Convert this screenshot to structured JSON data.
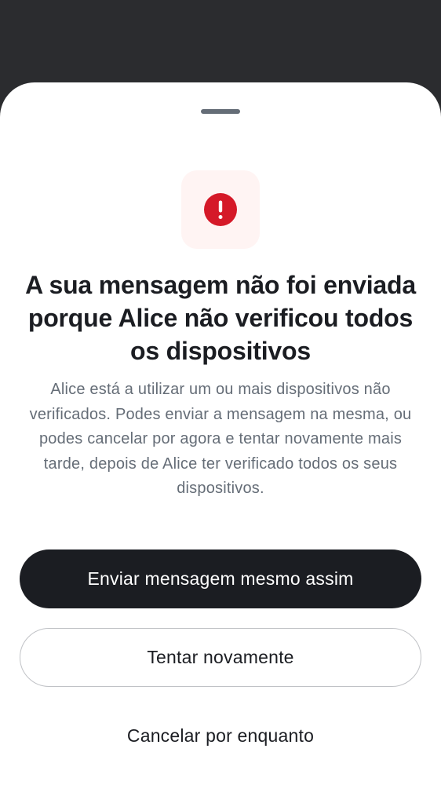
{
  "dialog": {
    "title": "A sua mensagem não foi enviada porque Alice não verificou todos os dispositivos",
    "message": "Alice está a utilizar um ou mais dispositivos não verificados. Podes enviar a mensagem na mesma, ou podes cancelar por agora e tentar novamente mais tarde, depois de Alice ter verificado todos os seus dispositivos.",
    "icon": "error-alert-icon",
    "icon_color": "#d51928",
    "icon_background": "#fff4f3"
  },
  "actions": {
    "send_anyway_label": "Enviar mensagem mesmo assim",
    "retry_label": "Tentar novamente",
    "cancel_label": "Cancelar por enquanto"
  },
  "colors": {
    "scrim": "#2b2c2f",
    "primary_button": "#1b1d22",
    "secondary_text": "#656d77"
  }
}
